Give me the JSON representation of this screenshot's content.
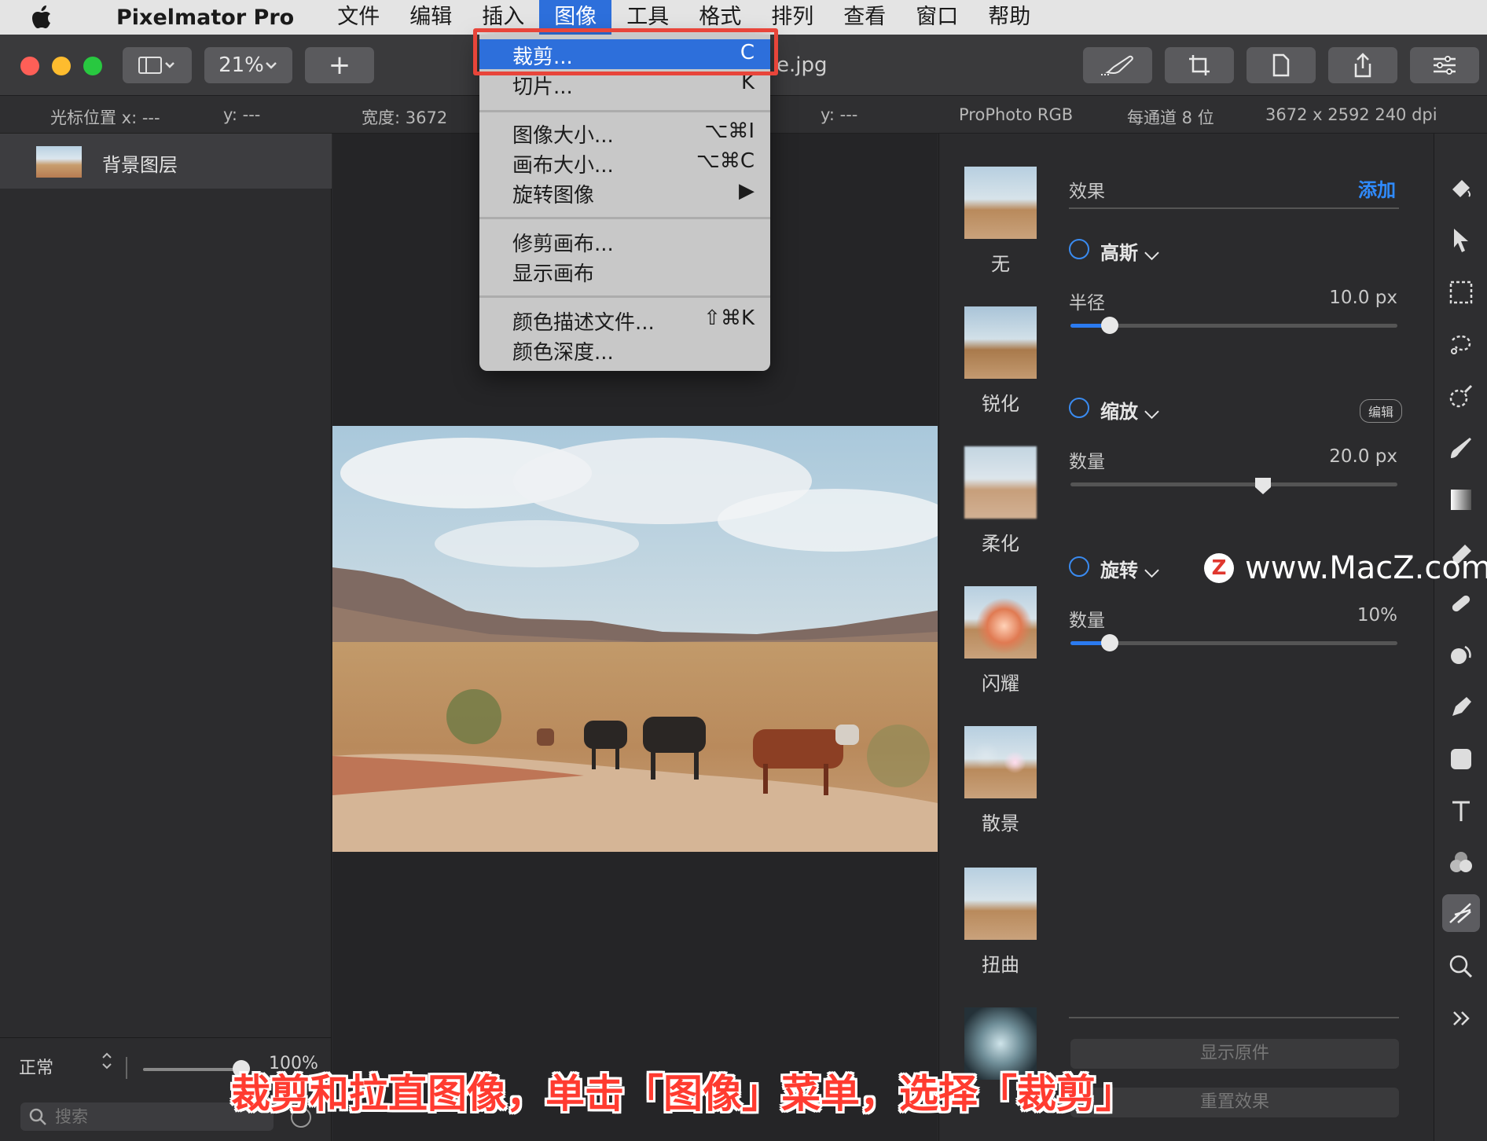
{
  "menubar": {
    "app_name": "Pixelmator Pro",
    "items": [
      "文件",
      "编辑",
      "插入",
      "图像",
      "工具",
      "格式",
      "排列",
      "查看",
      "窗口",
      "帮助"
    ],
    "active_item": "图像"
  },
  "toolbar": {
    "zoom": "21%",
    "add": "+",
    "document_title_suffix": "e.jpg"
  },
  "infobar": {
    "cursor_x": "光标位置 x:  ---",
    "cursor_y": "y:  ---",
    "width": "宽度:  3672",
    "sel_y": "y:  ---",
    "color_profile": "ProPhoto RGB",
    "bit_depth": "每通道 8 位",
    "dimensions": "3672 x 2592 240 dpi"
  },
  "image_menu": {
    "items": [
      {
        "label": "裁剪...",
        "shortcut": "C"
      },
      {
        "label": "切片...",
        "shortcut": "K"
      },
      {
        "label": "图像大小...",
        "shortcut": "⌥⌘I"
      },
      {
        "label": "画布大小...",
        "shortcut": "⌥⌘C"
      },
      {
        "label": "旋转图像",
        "shortcut": "▶"
      },
      {
        "label": "修剪画布...",
        "shortcut": ""
      },
      {
        "label": "显示画布",
        "shortcut": ""
      },
      {
        "label": "颜色描述文件...",
        "shortcut": "⇧⌘K"
      },
      {
        "label": "颜色深度...",
        "shortcut": ""
      }
    ]
  },
  "layers": {
    "layer_name": "背景图层",
    "blend_mode": "正常",
    "opacity": "100%",
    "search_placeholder": "搜索"
  },
  "effects_browser": {
    "items": [
      "无",
      "锐化",
      "柔化",
      "闪耀",
      "散景",
      "扭曲"
    ]
  },
  "settings": {
    "header": "效果",
    "add": "添加",
    "effects": [
      {
        "name": "高斯",
        "param": "半径",
        "value": "10.0 px",
        "fraction": 0.12
      },
      {
        "name": "缩放",
        "param": "数量",
        "value": "20.0 px",
        "fraction": 0.59,
        "edit": "编辑"
      },
      {
        "name": "旋转",
        "param": "数量",
        "value": "10%",
        "fraction": 0.12
      }
    ],
    "show_original": "显示原件",
    "reset_effects": "重置效果"
  },
  "watermark": {
    "logo": "Z",
    "text": "www.MacZ.com"
  },
  "caption": "裁剪和拉直图像，单击「图像」菜单，选择「裁剪」",
  "colors": {
    "accent": "#2d6fdb",
    "highlight_box": "#e8453a",
    "caption": "#ff3b30"
  }
}
